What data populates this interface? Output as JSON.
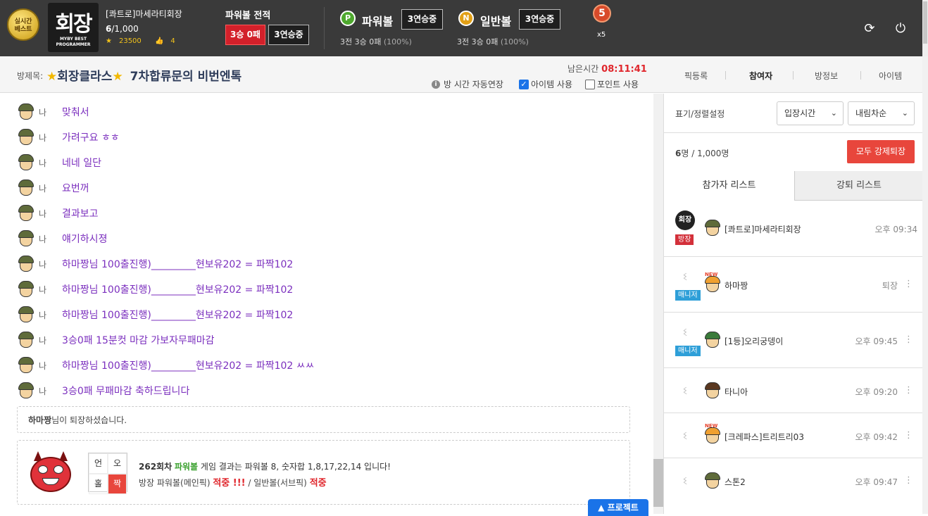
{
  "header": {
    "best_badge": "실시간\n베스트",
    "logo_text": "회장",
    "logo_sub": "MYBY BEST PROGRAMMER",
    "username": "[콰트로]마세라티회장",
    "count_current": "6",
    "count_max": "/1,000",
    "points": "23500",
    "likes": "4",
    "record_title": "파워볼 전적",
    "record_wl": "3승 0패",
    "record_streak": "3연승중",
    "power": {
      "ball": "P",
      "label": "파워볼",
      "streak": "3연승중",
      "sub": "3전 3승 0패",
      "pct": "(100%)"
    },
    "normal": {
      "ball": "N",
      "label": "일반볼",
      "streak": "3연승중",
      "sub": "3전 3승 0패",
      "pct": "(100%)"
    },
    "medal_num": "5",
    "medal_mult": "x5",
    "refresh_icon": "refresh-icon",
    "power_icon": "power-icon"
  },
  "room": {
    "label": "방제목:",
    "title_main": "회장클라스",
    "title_rest": "7차합류문의 비번엔톡",
    "time_label": "남은시간",
    "time_value": "08:11:41",
    "opt_auto": "방 시간 자동연장",
    "opt_item": "아이템 사용",
    "opt_point": "포인트 사용",
    "tabs": [
      "픽등록",
      "참여자",
      "방정보",
      "아이템"
    ]
  },
  "chat": {
    "messages": [
      {
        "who": "나",
        "text": "맞춰서"
      },
      {
        "who": "나",
        "text": "가려구요 ㅎㅎ"
      },
      {
        "who": "나",
        "text": "네네 일단"
      },
      {
        "who": "나",
        "text": "요번꺼"
      },
      {
        "who": "나",
        "text": "결과보고"
      },
      {
        "who": "나",
        "text": "얘기하시졍"
      },
      {
        "who": "나",
        "text": "하마짱님 100출진행)_________현보유202 = 파짝102"
      },
      {
        "who": "나",
        "text": "하마짱님 100출진행)_________현보유202 = 파짝102"
      },
      {
        "who": "나",
        "text": "하마짱님 100출진행)_________현보유202 = 파짝102"
      },
      {
        "who": "나",
        "text": "3승0패 15분컷 마감 가보자무패마감"
      },
      {
        "who": "나",
        "text": "하마짱님 100출진행)_________현보유202 = 파짝102 ㅆㅆ"
      },
      {
        "who": "나",
        "text": "3승0패 무패마감 축하드립니다"
      }
    ],
    "notice_name": "하마짱",
    "notice_text": "님이 퇴장하셨습니다.",
    "result": {
      "grid": [
        "언",
        "오",
        "홀",
        "짝"
      ],
      "round": "262회차",
      "game": "파워볼",
      "line1_rest": "게임 결과는 파워볼 8, 숫자합 1,8,17,22,14 입니다!",
      "line2_a": "방장 파워볼(메인픽)",
      "hit1": "적중 !!!",
      "line2_b": "/ 일반볼(서브픽)",
      "hit2": "적중"
    },
    "project_btn": "▲ 프로젝트"
  },
  "side": {
    "sort_label": "표기/정렬설정",
    "sort_by": "입장시간",
    "sort_order": "내림차순",
    "count_num": "6",
    "count_rest": "명 / 1,000명",
    "kick_all": "모두 강제퇴장",
    "tab_participants": "참가자 리스트",
    "tab_kicked": "강퇴 리스트",
    "participants": [
      {
        "name": "[콰트로]마세라티회장",
        "role": "방장",
        "time": "오후 09:34",
        "more": ""
      },
      {
        "name": "하마짱",
        "role": "매니저",
        "time": "퇴장",
        "more": "⋮"
      },
      {
        "name": "[1등]오리궁뎅이",
        "role": "매니저",
        "time": "오후 09:45",
        "more": "⋮"
      },
      {
        "name": "타니아",
        "role": "",
        "time": "오후 09:20",
        "more": "⋮"
      },
      {
        "name": "[크레파스]트리트리03",
        "role": "",
        "time": "오후 09:42",
        "more": "⋮"
      },
      {
        "name": "스톤2",
        "role": "",
        "time": "오후 09:47",
        "more": "⋮"
      }
    ],
    "new_tag": "NEW"
  }
}
